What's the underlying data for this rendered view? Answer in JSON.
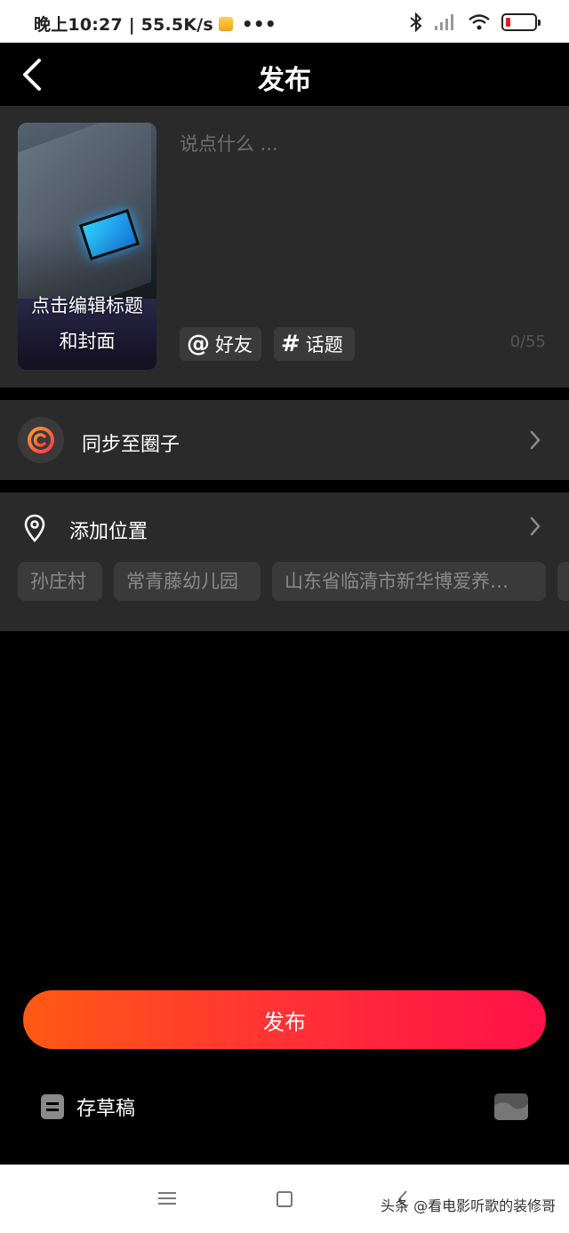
{
  "status_bar": {
    "time_speed": "晚上10:27 | 55.5K/s",
    "more": "•••"
  },
  "header": {
    "title": "发布"
  },
  "compose": {
    "cover_text": "点击编辑标题和封面",
    "caption_placeholder": "说点什么 ...",
    "mention_label": "好友",
    "topic_label": "话题",
    "char_counter": "0/55"
  },
  "sync": {
    "label": "同步至圈子"
  },
  "location": {
    "label": "添加位置",
    "suggestions": [
      "孙庄村",
      "常青藤幼儿园",
      "山东省临清市新华博爱养…",
      ""
    ]
  },
  "actions": {
    "publish_label": "发布",
    "draft_label": "存草稿"
  },
  "watermark": "头条 @看电影听歌的装修哥",
  "colors": {
    "publish_start": "#ff5a14",
    "publish_end": "#ff1148",
    "card_bg": "#2a2a2a",
    "chip_bg": "#3a3a3a"
  }
}
